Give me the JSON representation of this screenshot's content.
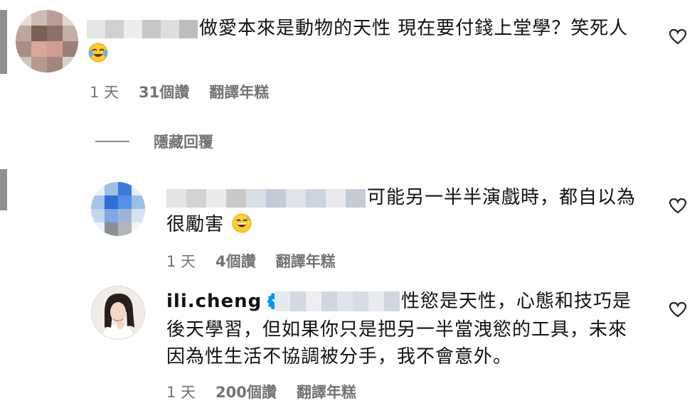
{
  "comments": [
    {
      "text_line1": "做愛本來是動物的天性 現在要付錢上堂學？笑死人",
      "text_line2": "",
      "time": "1 天",
      "likes": "31個讚",
      "translate": "翻譯年糕",
      "emoji": "face-with-tears-of-joy"
    },
    {
      "text_line1": "可能另一半半演戲時，都自以為",
      "text_line2": "很勵害",
      "time": "1 天",
      "likes": "4個讚",
      "translate": "翻譯年糕",
      "emoji": "grinning-face-with-sweat"
    },
    {
      "username": "ili.cheng",
      "text_line1": "性慾是天性，心態和技巧是",
      "text_line2": "後天學習，但如果你只是把另一半當洩慾的工具，未來",
      "text_line3": "因為性生活不協調被分手，我不會意外。",
      "time": "1 天",
      "likes": "200個讚",
      "translate": "翻譯年糕",
      "verified": true
    }
  ],
  "hide_replies": "隱藏回覆",
  "colors": {
    "meta": "#737373",
    "verified": "#0095f6",
    "text": "#111111"
  }
}
